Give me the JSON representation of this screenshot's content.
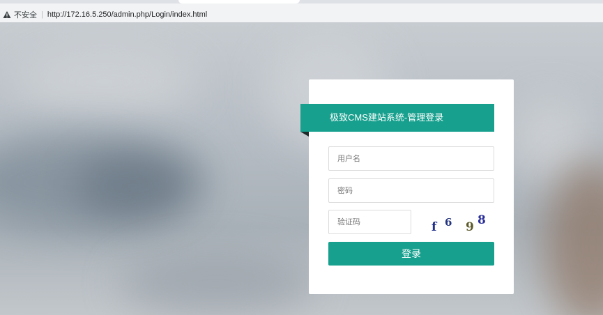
{
  "browser": {
    "security_label": "不安全",
    "url": "http://172.16.5.250/admin.php/Login/index.html"
  },
  "login": {
    "title": "极致CMS建站系统-管理登录",
    "username_placeholder": "用户名",
    "password_placeholder": "密码",
    "captcha_placeholder": "验证码",
    "captcha_chars": [
      {
        "char": "f",
        "color": "#1f2f8a"
      },
      {
        "char": "6",
        "color": "#24347f"
      },
      {
        "char": "9",
        "color": "#5c5a2a"
      },
      {
        "char": "8",
        "color": "#2b2f9a"
      }
    ],
    "submit_label": "登录"
  },
  "colors": {
    "accent": "#17a08e"
  }
}
